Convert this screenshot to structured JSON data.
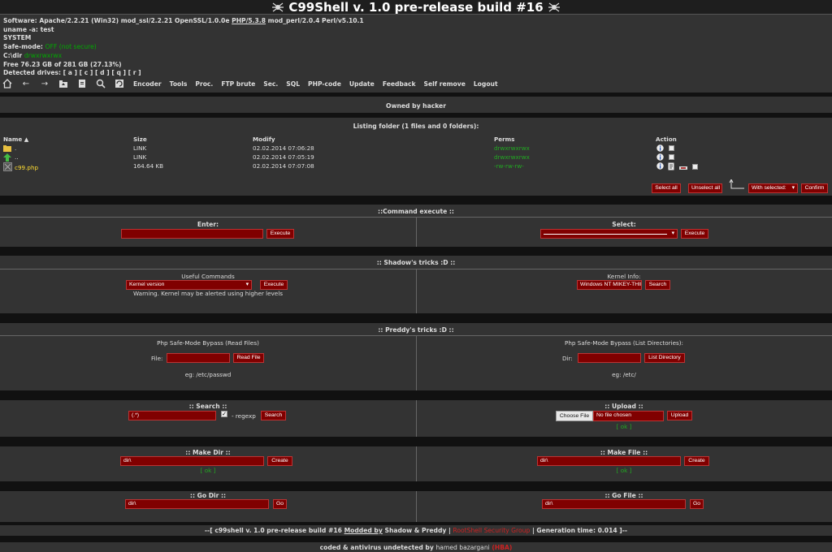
{
  "title": "C99Shell v. 1.0 pre-release build #16",
  "info": {
    "software_label": "Software:",
    "software_pre": "Apache/2.2.21 (Win32) mod_ssl/2.2.21 OpenSSL/1.0.0e",
    "software_php": "PHP/5.3.8",
    "software_post": "mod_perl/2.0.4 Perl/v5.10.1",
    "uname": "uname -a: test",
    "user": "SYSTEM",
    "safe_mode_label": "Safe-mode:",
    "safe_mode_value": "OFF (not secure)",
    "dir_label": "C:\\dir",
    "dir_perms": "drwxrwxrwx",
    "free": "Free 76.23 GB of 281 GB (27.13%)",
    "drives": "Detected drives: [ a ] [ c ] [ d ] [ q ] [ r ]"
  },
  "nav": {
    "icons": [
      "home-icon",
      "back-icon",
      "forward-icon",
      "up-folder-icon",
      "buffer-icon",
      "search-icon",
      "refresh-icon"
    ],
    "links": [
      "Encoder",
      "Tools",
      "Proc.",
      "FTP brute",
      "Sec.",
      "SQL",
      "PHP-code",
      "Update",
      "Feedback",
      "Self remove",
      "Logout"
    ]
  },
  "owned_by": "Owned by hacker",
  "listing": {
    "header": "Listing folder (1 files and 0 folders):",
    "columns": [
      "Name ▲",
      "Size",
      "Modify",
      "Perms",
      "Action"
    ],
    "rows": [
      {
        "name": ".",
        "size": "LINK",
        "modify": "02.02.2014 07:06:28",
        "perms": "drwxrwxrwx"
      },
      {
        "name": "..",
        "size": "LINK",
        "modify": "02.02.2014 07:05:19",
        "perms": "drwxrwxrwx"
      },
      {
        "name": "c99.php",
        "size": "164.64 KB",
        "modify": "02.02.2014 07:07:08",
        "perms": "-rw-rw-rw-"
      }
    ],
    "select_all": "Select all",
    "unselect_all": "Unselect all",
    "with_selected": "With selected:",
    "confirm": "Confirm"
  },
  "cmd": {
    "header": "::Command execute ::",
    "enter_label": "Enter:",
    "select_label": "Select:",
    "execute": "Execute"
  },
  "shadow": {
    "header": ":: Shadow's tricks :D ::",
    "useful_label": "Useful Commands",
    "useful_value": "Kernel version",
    "execute": "Execute",
    "warning": "Warning. Kernel may be alerted using higher levels",
    "kernel_label": "Kernel Info:",
    "kernel_value": "Windows NT MIKEY-THIN",
    "search": "Search"
  },
  "preddy": {
    "header": ":: Preddy's tricks :D ::",
    "read_title": "Php Safe-Mode Bypass (Read Files)",
    "file_label": "File:",
    "read_btn": "Read File",
    "read_eg": "eg: /etc/passwd",
    "list_title": "Php Safe-Mode Bypass (List Directories):",
    "dir_label": "Dir:",
    "list_btn": "List Directory",
    "list_eg": "eg: /etc/"
  },
  "search": {
    "header": ":: Search ::",
    "value": "(.*)",
    "regexp": "- regexp",
    "btn": "Search"
  },
  "upload": {
    "header": ":: Upload ::",
    "choose": "Choose File",
    "no_file": "No file chosen",
    "btn": "Upload",
    "ok": "[ ok ]"
  },
  "makedir": {
    "header": ":: Make Dir ::",
    "value": "dir\\",
    "btn": "Create",
    "ok": "[ ok ]"
  },
  "makefile": {
    "header": ":: Make File ::",
    "value": "dir\\",
    "btn": "Create",
    "ok": "[ ok ]"
  },
  "godir": {
    "header": ":: Go Dir ::",
    "value": "dir\\",
    "btn": "Go"
  },
  "gofile": {
    "header": ":: Go File ::",
    "value": "dir\\",
    "btn": "Go"
  },
  "footer": {
    "line1_pre": "--[ c99shell v. 1.0 pre-release build #16",
    "line1_modded": "Modded by",
    "line1_authors": "Shadow & Preddy |",
    "line1_group": "RootShell Security Group",
    "line1_post": "| Generation time: 0.014 ]--",
    "line2_pre": "coded & antivirus undetected by",
    "line2_name": "hamed bazargani",
    "line2_tag": "(HBA)"
  },
  "colors": {
    "bg": "#333333",
    "band": "#111111",
    "button": "#800000",
    "green": "#00aa00",
    "footer_red": "#cc2222"
  }
}
